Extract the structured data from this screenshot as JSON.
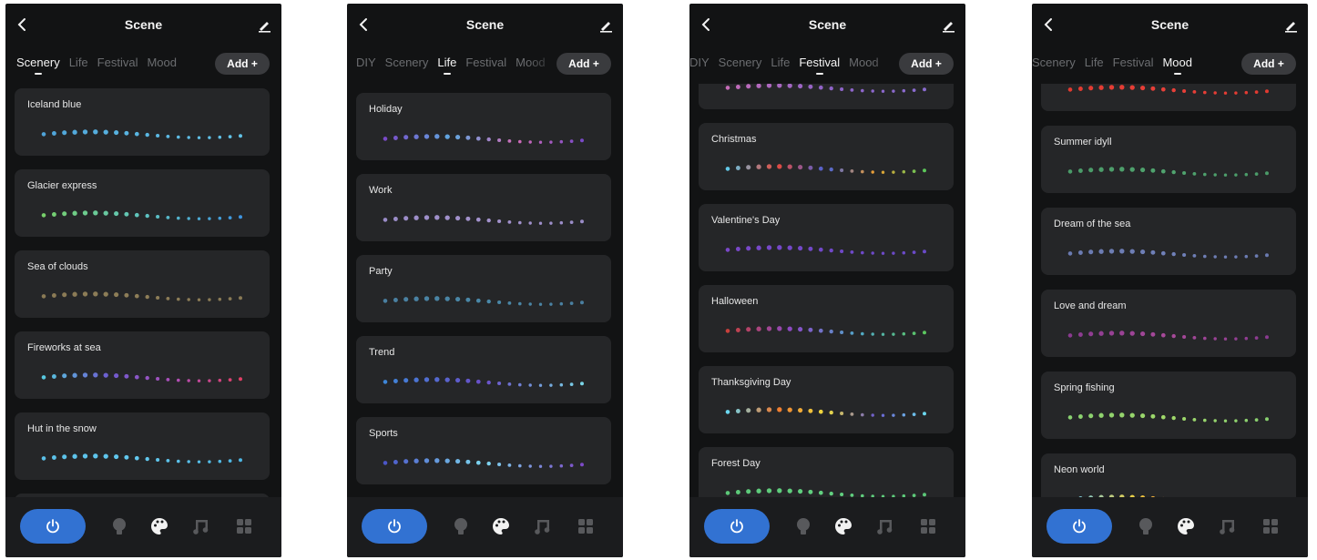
{
  "screens": [
    {
      "title": "Scene",
      "tabs": [
        {
          "label": "Scenery",
          "active": true
        },
        {
          "label": "Life",
          "active": false
        },
        {
          "label": "Festival",
          "active": false
        },
        {
          "label": "Mood",
          "active": false
        }
      ],
      "add_label": "Add +",
      "scenes": [
        {
          "name": "Iceland blue",
          "colors": [
            "#4fa3d8",
            "#5ab6e2",
            "#62c3e8"
          ]
        },
        {
          "name": "Glacier express",
          "colors": [
            "#77d06a",
            "#5fc4c0",
            "#3e95e2"
          ]
        },
        {
          "name": "Sea of clouds",
          "colors": [
            "#8a7a55",
            "#8e7e58",
            "#8a7a55"
          ]
        },
        {
          "name": "Fireworks at sea",
          "colors": [
            "#57c8e0",
            "#6d5bd0",
            "#b04fb8",
            "#e23f66"
          ]
        },
        {
          "name": "Hut in the snow",
          "colors": [
            "#5ac0e8",
            "#62c8ee",
            "#4eb6e4"
          ]
        },
        {
          "name": "",
          "colors": [
            "#9a9a9a",
            "#9a9a9a"
          ]
        }
      ]
    },
    {
      "title": "Scene",
      "tabs": [
        {
          "label": "DIY",
          "active": false
        },
        {
          "label": "Scenery",
          "active": false
        },
        {
          "label": "Life",
          "active": true
        },
        {
          "label": "Festival",
          "active": false
        },
        {
          "label": "Mood",
          "active": false
        }
      ],
      "add_label": "Add +",
      "scenes": [
        {
          "name": "Holiday",
          "colors": [
            "#7a4ac8",
            "#5fa8e0",
            "#d06cb8",
            "#7a4ac8"
          ]
        },
        {
          "name": "Work",
          "colors": [
            "#9a8cc8",
            "#a492cc",
            "#9a8cc8"
          ]
        },
        {
          "name": "Party",
          "colors": [
            "#4a7fa0",
            "#4a88a8",
            "#4a7fa0"
          ]
        },
        {
          "name": "Trend",
          "colors": [
            "#3e86d8",
            "#6a4ec8",
            "#7ad6e8"
          ]
        },
        {
          "name": "Sports",
          "colors": [
            "#4b56c8",
            "#7ed8f0",
            "#7d4ac8"
          ]
        },
        {
          "name": "",
          "colors": [
            "#9a9a9a",
            "#9a9a9a"
          ]
        }
      ]
    },
    {
      "title": "Scene",
      "tabs": [
        {
          "label": "DIY",
          "active": false
        },
        {
          "label": "Scenery",
          "active": false
        },
        {
          "label": "Life",
          "active": false
        },
        {
          "label": "Festival",
          "active": true
        },
        {
          "label": "Mood",
          "active": false
        }
      ],
      "add_label": "Add +",
      "scenes": [
        {
          "name": "",
          "colors": [
            "#c56cb8",
            "#8e62c8",
            "#8a6cd0"
          ]
        },
        {
          "name": "Christmas",
          "colors": [
            "#62c8e8",
            "#e24a3e",
            "#4a64d8",
            "#f0a030",
            "#5cc85a"
          ]
        },
        {
          "name": "Valentine's Day",
          "colors": [
            "#7a48c8",
            "#7048c8",
            "#6a4ac8"
          ]
        },
        {
          "name": "Halloween",
          "colors": [
            "#c8403c",
            "#8a4ac8",
            "#50a8c8",
            "#5cc860"
          ]
        },
        {
          "name": "Thanksgiving Day",
          "colors": [
            "#6cd8f0",
            "#f07a30",
            "#f0e040",
            "#6a5ad0",
            "#6cd8f0"
          ]
        },
        {
          "name": "Forest Day",
          "colors": [
            "#5cc878",
            "#62d080",
            "#5cc878"
          ]
        }
      ]
    },
    {
      "title": "Scene",
      "tabs": [
        {
          "label": "Scenery",
          "active": false
        },
        {
          "label": "Life",
          "active": false
        },
        {
          "label": "Festival",
          "active": false
        },
        {
          "label": "Mood",
          "active": true
        }
      ],
      "add_label": "Add +",
      "scenes": [
        {
          "name": "",
          "colors": [
            "#e23a30",
            "#e8403a",
            "#e23a30"
          ]
        },
        {
          "name": "Summer idyll",
          "colors": [
            "#4a9a68",
            "#50a46e",
            "#4a9a68"
          ]
        },
        {
          "name": "Dream of the sea",
          "colors": [
            "#6a7ab0",
            "#7080b8",
            "#6a7ab0"
          ]
        },
        {
          "name": "Love and dream",
          "colors": [
            "#8a3a90",
            "#a84a9a",
            "#8a3a90"
          ]
        },
        {
          "name": "Spring fishing",
          "colors": [
            "#88d070",
            "#a0d86a",
            "#88d070"
          ]
        },
        {
          "name": "Neon world",
          "colors": [
            "#6cc8f0",
            "#f0d040",
            "#e24a30",
            "#3e60d8"
          ]
        }
      ]
    }
  ]
}
